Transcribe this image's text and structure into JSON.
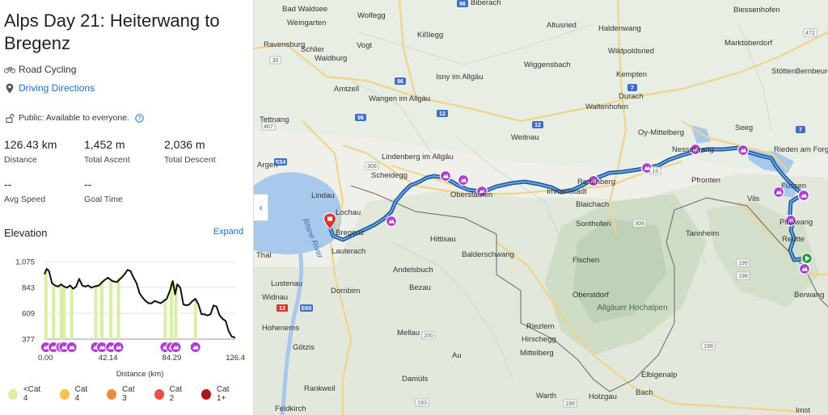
{
  "route": {
    "title": "Alps Day 21: Heiterwang to Bregenz",
    "activity": "Road Cycling",
    "directions_link": "Driving Directions",
    "privacy": "Public: Available to everyone.",
    "stats": [
      {
        "value": "126.43 km",
        "label": "Distance"
      },
      {
        "value": "1,452 m",
        "label": "Total Ascent"
      },
      {
        "value": "2,036 m",
        "label": "Total Descent"
      },
      {
        "value": "--",
        "label": "Avg Speed"
      },
      {
        "value": "--",
        "label": "Goal Time"
      }
    ]
  },
  "elevation": {
    "title": "Elevation",
    "expand": "Expand",
    "x_axis_label": "Distance (km)"
  },
  "legend": [
    {
      "label": "<Cat 4",
      "color": "#d7f0a6"
    },
    {
      "label": "Cat 4",
      "color": "#f6c444"
    },
    {
      "label": "Cat 3",
      "color": "#f28c38"
    },
    {
      "label": "Cat 2",
      "color": "#ef4d4d"
    },
    {
      "label": "Cat 1+",
      "color": "#b01818"
    }
  ],
  "chart_data": {
    "type": "area",
    "xlabel": "Distance (km)",
    "ylabel": "",
    "x_ticks": [
      "0.00",
      "42.14",
      "84.29",
      "126.4"
    ],
    "y_ticks": [
      "1,075",
      "843",
      "609",
      "377"
    ],
    "xlim": [
      0,
      126.4
    ],
    "ylim": [
      377,
      1075
    ],
    "x": [
      0,
      1.5,
      3,
      5,
      7,
      9,
      11,
      13,
      15,
      17,
      19,
      21,
      23,
      25,
      27,
      29,
      31,
      33,
      36,
      39,
      42,
      45,
      48,
      51,
      53,
      55,
      57,
      59,
      61,
      63,
      65,
      67,
      69,
      71,
      73,
      75,
      77,
      79,
      81,
      83,
      85,
      86.5,
      88,
      90,
      92,
      94,
      96,
      98,
      100,
      102,
      104,
      106,
      108,
      110,
      112,
      114,
      116,
      118,
      120,
      122,
      124,
      126.4
    ],
    "y": [
      960,
      1010,
      990,
      880,
      860,
      850,
      870,
      850,
      840,
      860,
      830,
      850,
      920,
      860,
      850,
      860,
      840,
      850,
      860,
      900,
      930,
      900,
      890,
      930,
      960,
      1000,
      990,
      930,
      880,
      790,
      750,
      720,
      700,
      700,
      720,
      710,
      700,
      720,
      740,
      810,
      900,
      780,
      870,
      840,
      690,
      680,
      690,
      720,
      740,
      690,
      600,
      600,
      590,
      600,
      680,
      670,
      590,
      560,
      540,
      450,
      400,
      390
    ],
    "climb_markers_km": [
      1,
      6,
      11,
      13,
      18,
      34,
      38,
      44,
      49,
      80,
      84,
      87,
      100
    ]
  },
  "map": {
    "places": [
      "Bad Waldsee",
      "Biberach",
      "Weingarten",
      "Wolfegg",
      "Ravensburg",
      "Kißlegg",
      "Schlier",
      "Waldburg",
      "Vogt",
      "Amtzell",
      "Wangen im Allgäu",
      "Isny im Allgäu",
      "Tettnang",
      "Lindau",
      "Lochau",
      "Bregenz",
      "Lauterach",
      "Scheidegg",
      "Lindenberg im Allgäu",
      "Oberstaufen",
      "Immenstadt",
      "Rettenberg",
      "Nesselwang",
      "Pfronten",
      "Füssen",
      "Vils",
      "Pinswang",
      "Reutte",
      "Berwang",
      "Kempten",
      "Durach",
      "Waltenhofen",
      "Wiggensbach",
      "Oy-Mittelberg",
      "Seeg",
      "Rieden am Forggensee",
      "Marktoberdorf",
      "Biessenhofen",
      "Stötten",
      "Bernbeuren",
      "Altusried",
      "Haldenwang",
      "Wildpoldsried",
      "Weitnau",
      "Blaichach",
      "Sonthofen",
      "Fischen",
      "Oberstdorf",
      "Tannheim",
      "Hittisau",
      "Balderschwang",
      "Andelsbuch",
      "Bezau",
      "Mellau",
      "Au",
      "Damüls",
      "Riezlern",
      "Hirschegg",
      "Mittelberg",
      "Warth",
      "Holzgau",
      "Bach",
      "Elbigenalp",
      "Imst",
      "Dornbirn",
      "Lustenau",
      "Widnau",
      "Hohenems",
      "Götzis",
      "Rankweil",
      "Feldkirch",
      "Thal",
      "Argen",
      "Allgäuer Hochalpen",
      "Rhine River"
    ]
  }
}
